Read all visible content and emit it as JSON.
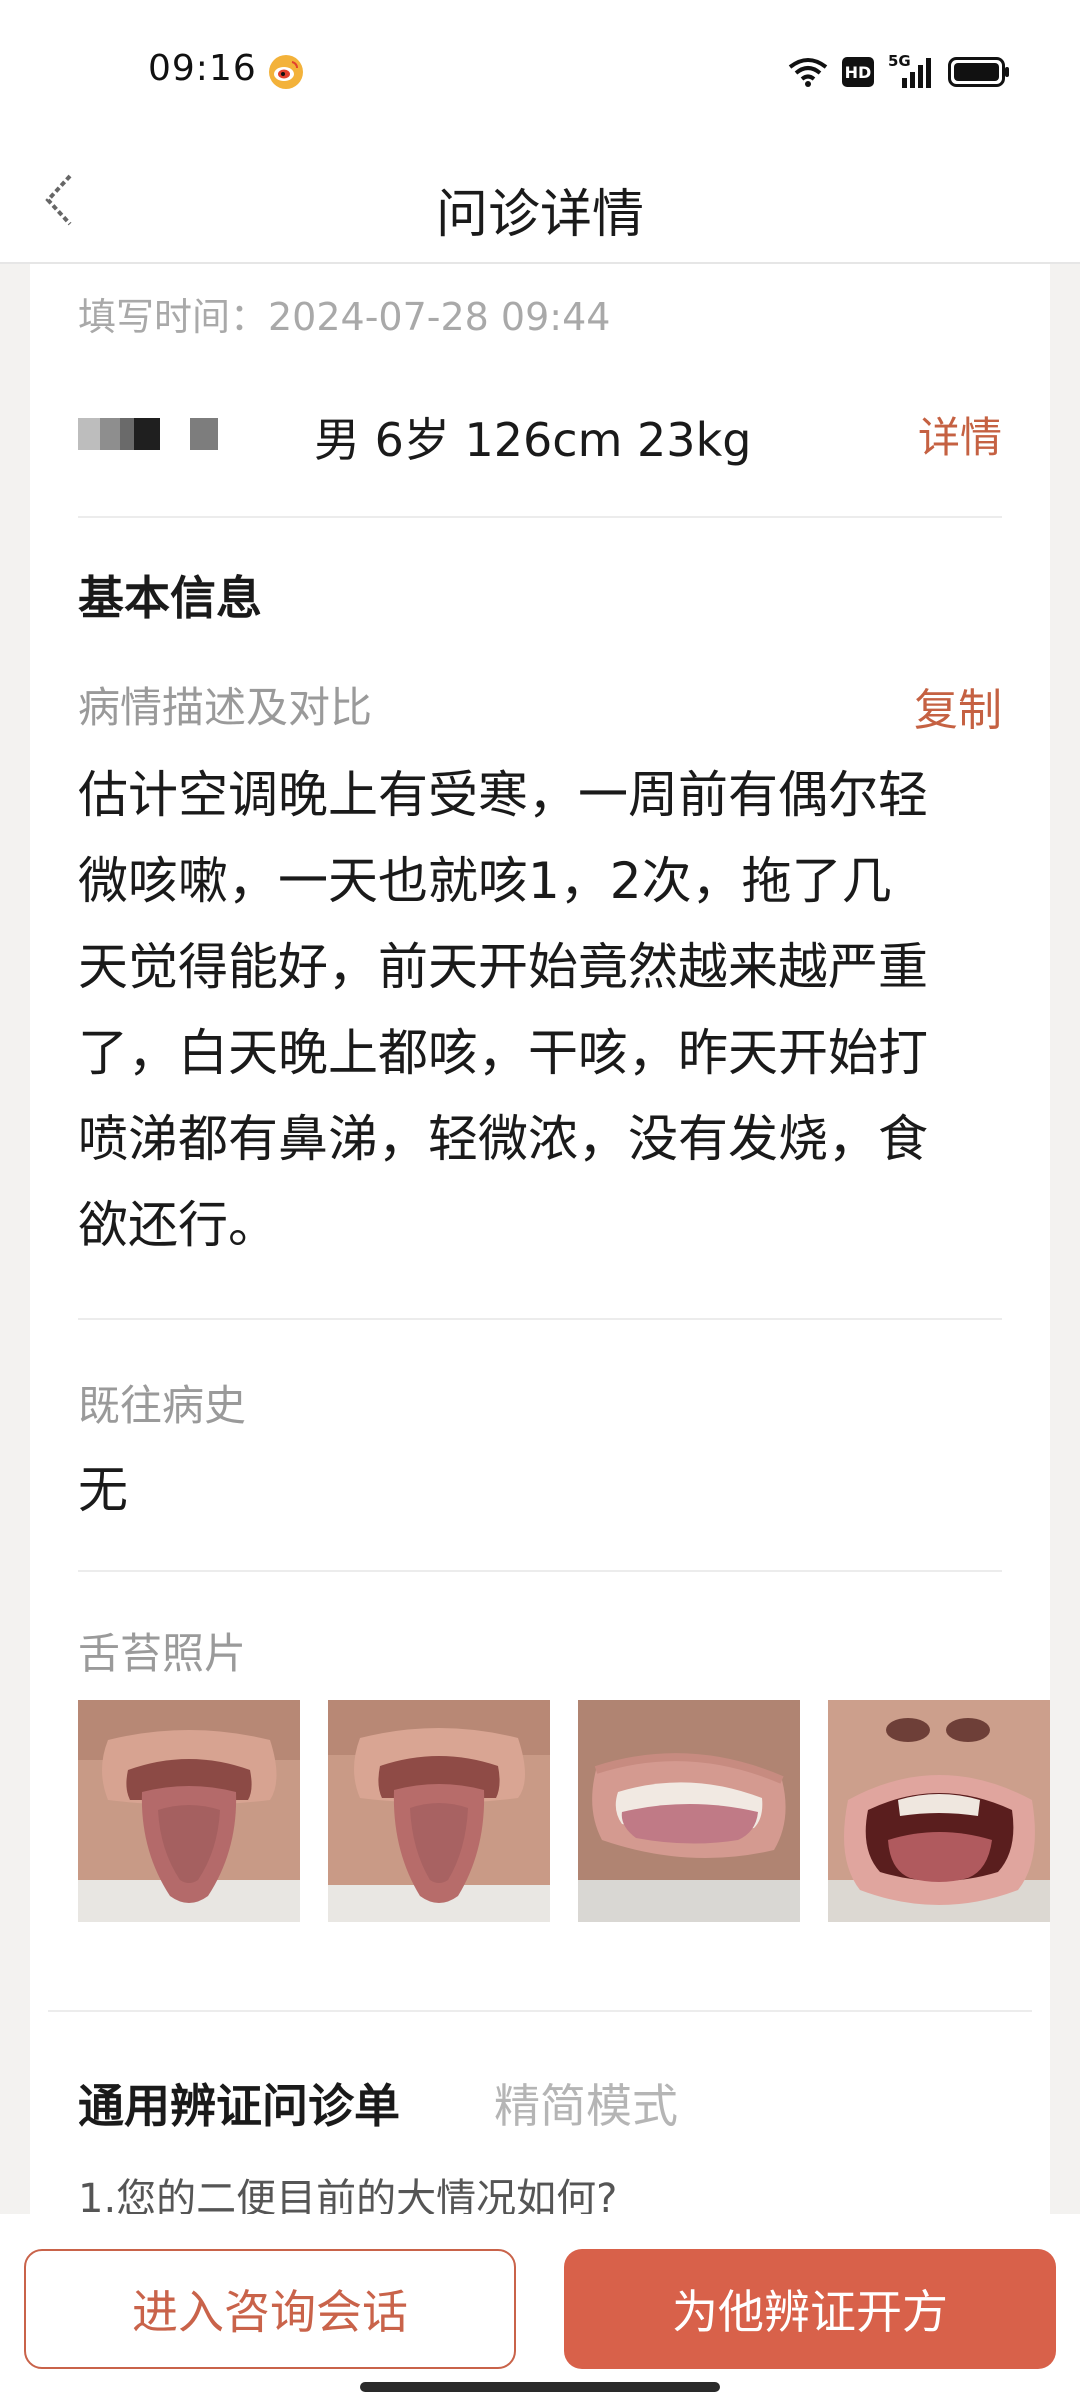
{
  "status_bar": {
    "time": "09:16",
    "icons": [
      "weibo-icon",
      "wifi-icon",
      "hd-icon",
      "5g-signal-icon",
      "battery-icon"
    ],
    "hd_label": "HD",
    "network_label": "5G"
  },
  "nav": {
    "title": "问诊详情",
    "back_icon": "back-arrow-icon"
  },
  "record": {
    "fill_time": "填写时间：2024-07-28 09:44",
    "patient_info": "男 6岁 126cm 23kg",
    "detail_label": "详情"
  },
  "basic_info": {
    "title": "基本信息",
    "desc_label": "病情描述及对比",
    "copy_label": "复制",
    "desc_lines": [
      "估计空调晚上有受寒，一周前有偶尔轻",
      "微咳嗽，一天也就咳1，2次，拖了几",
      "天觉得能好，前天开始竟然越来越严重",
      "了，白天晚上都咳，干咳，昨天开始打",
      "喷涕都有鼻涕，轻微浓，没有发烧，食",
      "欲还行。"
    ],
    "history_label": "既往病史",
    "history_value": "无",
    "tongue_label": "舌苔照片"
  },
  "photos": [
    {
      "name": "tongue-photo-1"
    },
    {
      "name": "tongue-photo-2"
    },
    {
      "name": "tongue-photo-3"
    },
    {
      "name": "tongue-photo-4"
    }
  ],
  "form": {
    "title": "通用辨证问诊单",
    "mode_label": "精简模式",
    "cut_text": "1.您的二便目前的大情况如何?"
  },
  "actions": {
    "enter_chat": "进入咨询会话",
    "prescribe": "为他辨证开方"
  },
  "colors": {
    "accent": "#c56142",
    "primary_button": "#d8614a",
    "background": "#f3f2f0"
  }
}
